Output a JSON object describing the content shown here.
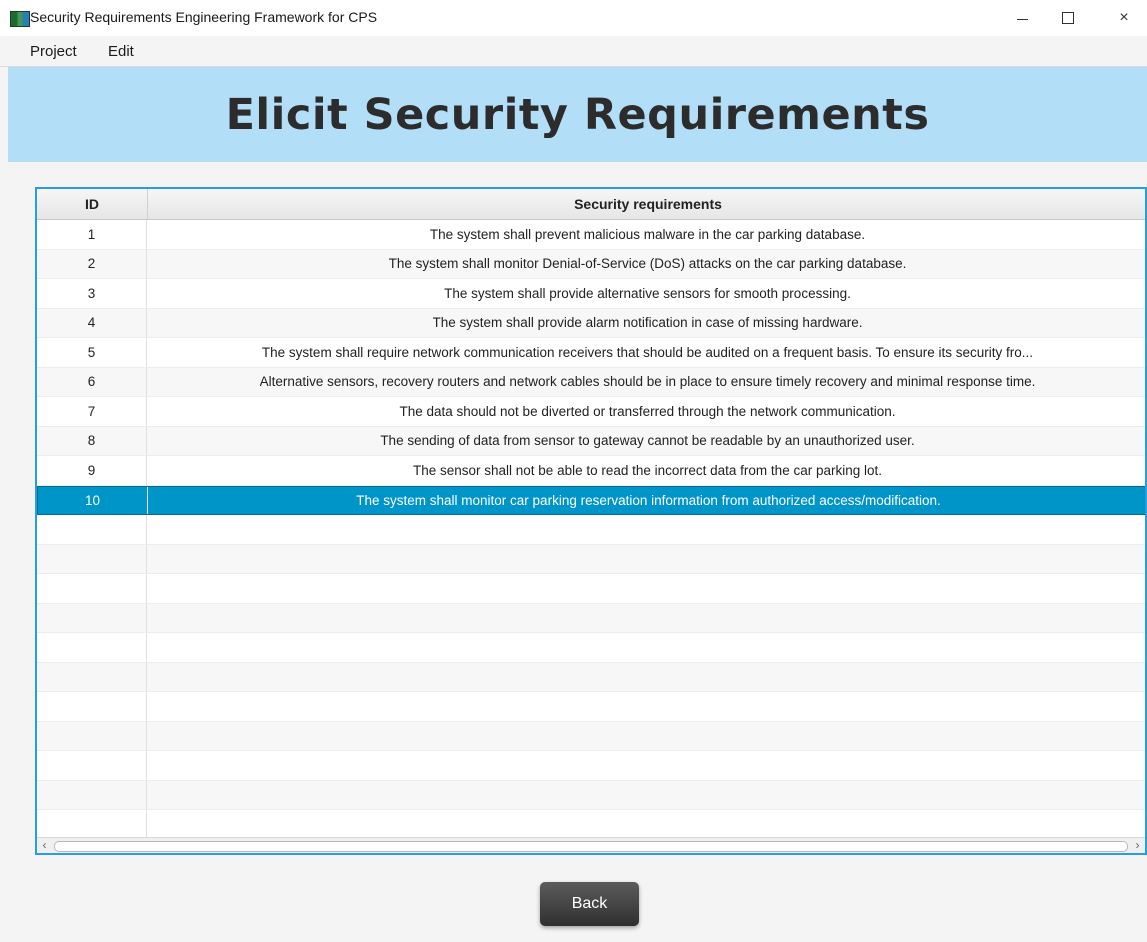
{
  "window": {
    "title": "Security Requirements Engineering Framework for CPS",
    "controls": [
      "minimize",
      "maximize",
      "close"
    ],
    "close_glyph": "×"
  },
  "menu": {
    "items": [
      "Project",
      "Edit"
    ]
  },
  "header": {
    "title": "Elicit Security Requirements",
    "band_color": "#b3def8"
  },
  "table": {
    "columns": [
      "ID",
      "Security requirements"
    ],
    "rows": [
      {
        "id": "1",
        "requirement": "The system shall prevent malicious malware in the car parking database."
      },
      {
        "id": "2",
        "requirement": "The system shall monitor Denial-of-Service (DoS) attacks on the car parking database."
      },
      {
        "id": "3",
        "requirement": "The system shall provide alternative sensors for smooth processing."
      },
      {
        "id": "4",
        "requirement": "The system shall provide alarm notification in case of missing hardware."
      },
      {
        "id": "5",
        "requirement": "The system shall require network communication receivers that should be audited on a frequent basis. To ensure its security fro..."
      },
      {
        "id": "6",
        "requirement": "Alternative sensors, recovery routers and network cables should be in place to ensure timely recovery and minimal response time."
      },
      {
        "id": "7",
        "requirement": "The data should not be diverted or transferred through the network communication."
      },
      {
        "id": "8",
        "requirement": "The sending of data from sensor to gateway cannot be readable by an unauthorized user."
      },
      {
        "id": "9",
        "requirement": "The sensor shall not be able to read the incorrect data from the car parking lot."
      },
      {
        "id": "10",
        "requirement": "The system shall monitor car parking reservation information from authorized access/modification."
      }
    ],
    "selected_id": "10",
    "selection_color": "#0095c9",
    "border_color": "#2a9de0"
  },
  "scrollbar": {
    "left_arrow": "‹",
    "right_arrow": "›"
  },
  "buttons": {
    "back_label": "Back"
  }
}
